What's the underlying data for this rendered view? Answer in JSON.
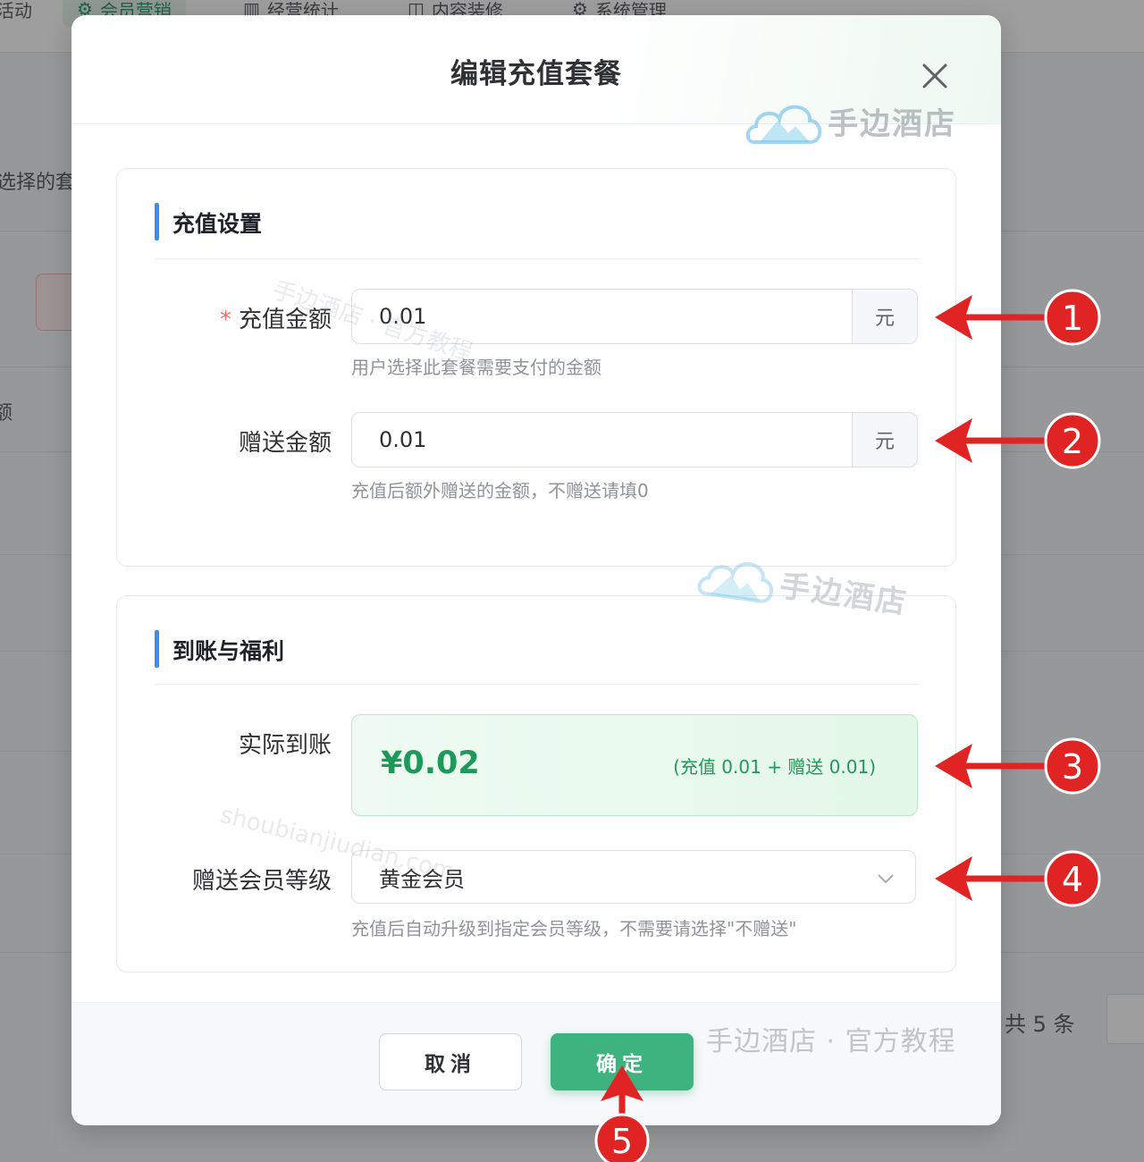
{
  "background": {
    "tabs": [
      {
        "label": "活动"
      },
      {
        "label": "会员营销"
      },
      {
        "label": "经营统计"
      },
      {
        "label": "内容装修"
      },
      {
        "label": "系统管理"
      }
    ],
    "side_text_1": "选择的套",
    "side_text_2": "额",
    "pager_total": "共 5 条"
  },
  "dialog": {
    "title": "编辑充值套餐",
    "section1": {
      "title": "充值设置",
      "recharge_amount": {
        "required_mark": "*",
        "label": "充值金额",
        "value": "0.01",
        "suffix": "元",
        "hint": "用户选择此套餐需要支付的金额"
      },
      "bonus_amount": {
        "label": "赠送金额",
        "value": "0.01",
        "suffix": "元",
        "hint": "充值后额外赠送的金额，不赠送请填0"
      }
    },
    "section2": {
      "title": "到账与福利",
      "actual_credit": {
        "label": "实际到账",
        "amount": "¥0.02",
        "detail": "(充值 0.01 + 赠送 0.01)"
      },
      "member_level": {
        "label": "赠送会员等级",
        "selected": "黄金会员",
        "hint": "充值后自动升级到指定会员等级，不需要请选择\"不赠送\""
      }
    },
    "footer": {
      "cancel_label": "取消",
      "confirm_label": "确定"
    }
  },
  "watermarks": {
    "brand": "手边酒店",
    "tilted_1": "手边酒店 · 官方教程",
    "tilted_2": "shoubianjiudian.com",
    "footer": "手边酒店 · 官方教程"
  },
  "annotations": {
    "badges": [
      "1",
      "2",
      "3",
      "4",
      "5"
    ],
    "color": "#e02424"
  },
  "colors": {
    "accent_green": "#3eb27f",
    "section_bar": "#3b8ef0",
    "required": "#f56c6c",
    "amount_green": "#1c9a5a"
  }
}
